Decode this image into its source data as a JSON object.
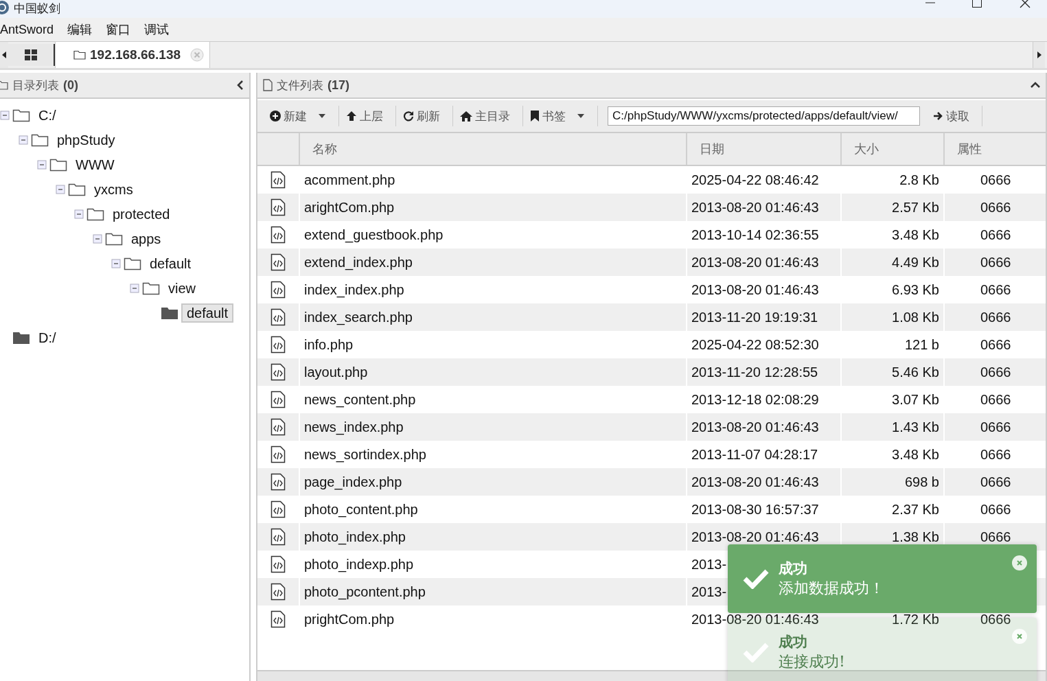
{
  "window": {
    "title": "中国蚁剑"
  },
  "menu": [
    "AntSword",
    "编辑",
    "窗口",
    "调试"
  ],
  "tabs": [
    {
      "label": "192.168.66.138",
      "selected": true
    }
  ],
  "dir_panel": {
    "title": "目录列表",
    "count": "(0)"
  },
  "tree": [
    {
      "label": "C:/",
      "selected": false,
      "children": [
        {
          "label": "phpStudy",
          "selected": false,
          "children": [
            {
              "label": "WWW",
              "selected": false,
              "children": [
                {
                  "label": "yxcms",
                  "selected": false,
                  "children": [
                    {
                      "label": "protected",
                      "selected": false,
                      "children": [
                        {
                          "label": "apps",
                          "selected": false,
                          "children": [
                            {
                              "label": "default",
                              "selected": false,
                              "children": [
                                {
                                  "label": "view",
                                  "selected": false,
                                  "children": [
                                    {
                                      "label": "default",
                                      "selected": true
                                    }
                                  ]
                                }
                              ]
                            }
                          ]
                        }
                      ]
                    }
                  ]
                }
              ]
            }
          ]
        }
      ]
    },
    {
      "label": "D:/",
      "selected": false
    }
  ],
  "file_panel": {
    "title": "文件列表",
    "count": "(17)"
  },
  "toolbar": [
    {
      "label": "新建",
      "dropdown": true
    },
    {
      "label": "上层",
      "dropdown": false
    },
    {
      "label": "刷新",
      "dropdown": false
    },
    {
      "label": "主目录",
      "dropdown": false
    },
    {
      "label": "书签",
      "dropdown": true
    }
  ],
  "path": {
    "value": "C:/phpStudy/WWW/yxcms/protected/apps/default/view/"
  },
  "read_button": "读取",
  "table": {
    "columns": [
      "名称",
      "日期",
      "大小",
      "属性"
    ],
    "rows": [
      {
        "name": "acomment.php",
        "date": "2025-04-22 08:46:42",
        "size": "2.8 Kb",
        "attr": "0666"
      },
      {
        "name": "arightCom.php",
        "date": "2013-08-20 01:46:43",
        "size": "2.57 Kb",
        "attr": "0666"
      },
      {
        "name": "extend_guestbook.php",
        "date": "2013-10-14 02:36:55",
        "size": "3.48 Kb",
        "attr": "0666"
      },
      {
        "name": "extend_index.php",
        "date": "2013-08-20 01:46:43",
        "size": "4.49 Kb",
        "attr": "0666"
      },
      {
        "name": "index_index.php",
        "date": "2013-08-20 01:46:43",
        "size": "6.93 Kb",
        "attr": "0666"
      },
      {
        "name": "index_search.php",
        "date": "2013-11-20 19:19:31",
        "size": "1.08 Kb",
        "attr": "0666"
      },
      {
        "name": "info.php",
        "date": "2025-04-22 08:52:30",
        "size": "121 b",
        "attr": "0666"
      },
      {
        "name": "layout.php",
        "date": "2013-11-20 12:28:55",
        "size": "5.46 Kb",
        "attr": "0666"
      },
      {
        "name": "news_content.php",
        "date": "2013-12-18 02:08:29",
        "size": "3.07 Kb",
        "attr": "0666"
      },
      {
        "name": "news_index.php",
        "date": "2013-08-20 01:46:43",
        "size": "1.43 Kb",
        "attr": "0666"
      },
      {
        "name": "news_sortindex.php",
        "date": "2013-11-07 04:28:17",
        "size": "3.48 Kb",
        "attr": "0666"
      },
      {
        "name": "page_index.php",
        "date": "2013-08-20 01:46:43",
        "size": "698 b",
        "attr": "0666"
      },
      {
        "name": "photo_content.php",
        "date": "2013-08-30 16:57:37",
        "size": "2.37 Kb",
        "attr": "0666"
      },
      {
        "name": "photo_index.php",
        "date": "2013-08-20 01:46:43",
        "size": "1.38 Kb",
        "attr": "0666"
      },
      {
        "name": "photo_indexp.php",
        "date": "2013-"
      },
      {
        "name": "photo_pcontent.php",
        "date": "2013-"
      },
      {
        "name": "prightCom.php",
        "date": "2013-08-20 01:46:43",
        "size": "1.72 Kb",
        "attr": "0666"
      }
    ]
  },
  "toasts": [
    {
      "title": "成功",
      "message": "添加数据成功！",
      "faded": false
    },
    {
      "title": "成功",
      "message": "连接成功!",
      "faded": true
    }
  ]
}
